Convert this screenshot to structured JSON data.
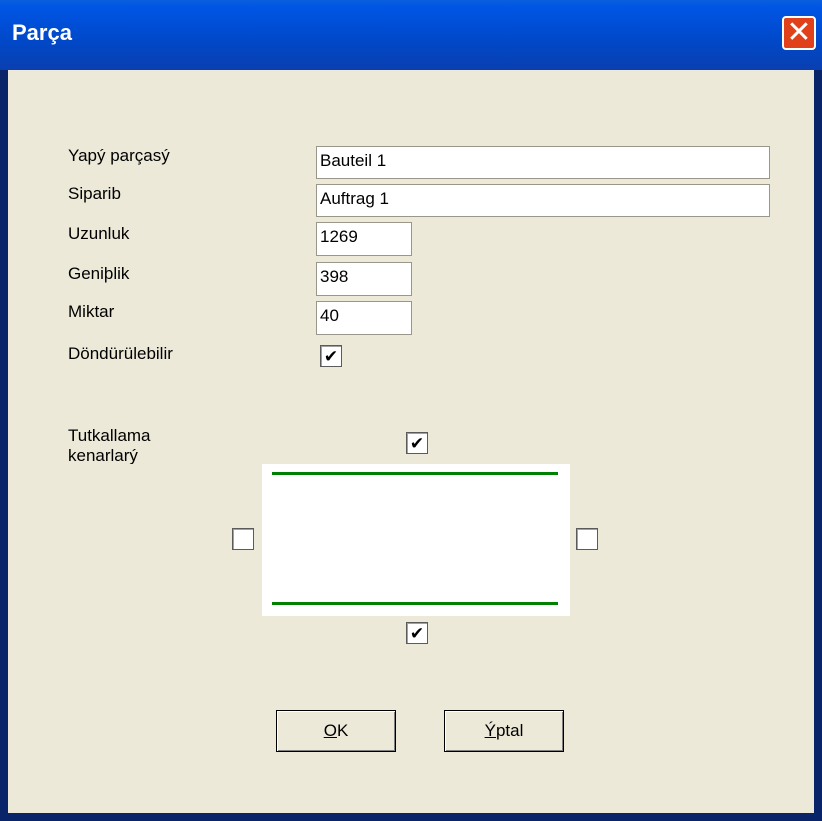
{
  "window": {
    "title": "Parça",
    "close_symbol": "✕",
    "accent_color": "#0055e5",
    "close_color": "#e0411a"
  },
  "form": {
    "part_label": "Yapý parçasý",
    "part_value": "Bauteil 1",
    "order_label": "Siparib",
    "order_value": "Auftrag 1",
    "length_label": "Uzunluk",
    "length_value": "1269",
    "width_label": "Geniþlik",
    "width_value": "398",
    "quantity_label": "Miktar",
    "quantity_value": "40",
    "rotatable_label": "Döndürülebilir",
    "rotatable_checked": true
  },
  "edges": {
    "label": "Tutkallama kenarlarý",
    "top_checked": true,
    "bottom_checked": true,
    "left_checked": false,
    "right_checked": false,
    "edge_color": "#008000"
  },
  "buttons": {
    "ok_accel": "O",
    "ok_rest": "K",
    "cancel_accel": "Ý",
    "cancel_rest": "ptal"
  },
  "check_glyph": "✔"
}
